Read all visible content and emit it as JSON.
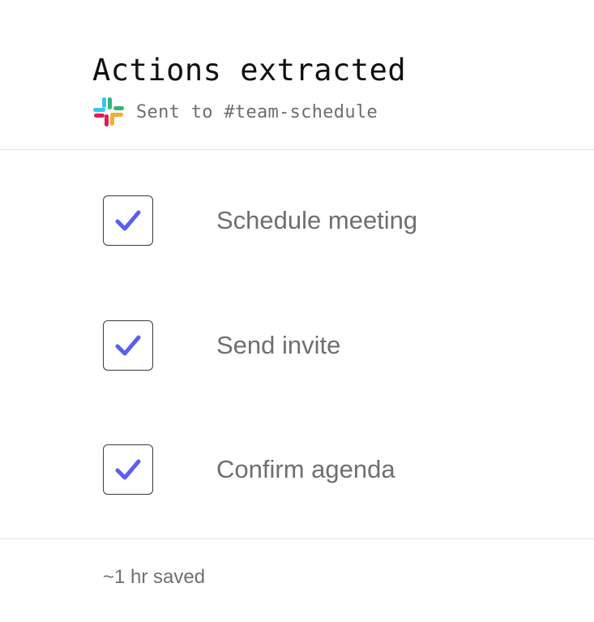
{
  "header": {
    "title": "Actions extracted",
    "channel_icon": "slack-icon",
    "sent_text": "Sent to #team-schedule"
  },
  "actions": [
    {
      "label": "Schedule meeting",
      "checked": true
    },
    {
      "label": "Send invite",
      "checked": true
    },
    {
      "label": "Confirm agenda",
      "checked": true
    }
  ],
  "footer": {
    "saved_text": "~1 hr saved"
  },
  "colors": {
    "check_accent": "#5b5ef0",
    "label_gray": "#6f6f6f",
    "divider": "#e6e6e6",
    "slack_blue": "#36c5f0",
    "slack_green": "#2eb67d",
    "slack_yellow": "#ecb22e",
    "slack_red": "#e01e5a"
  }
}
